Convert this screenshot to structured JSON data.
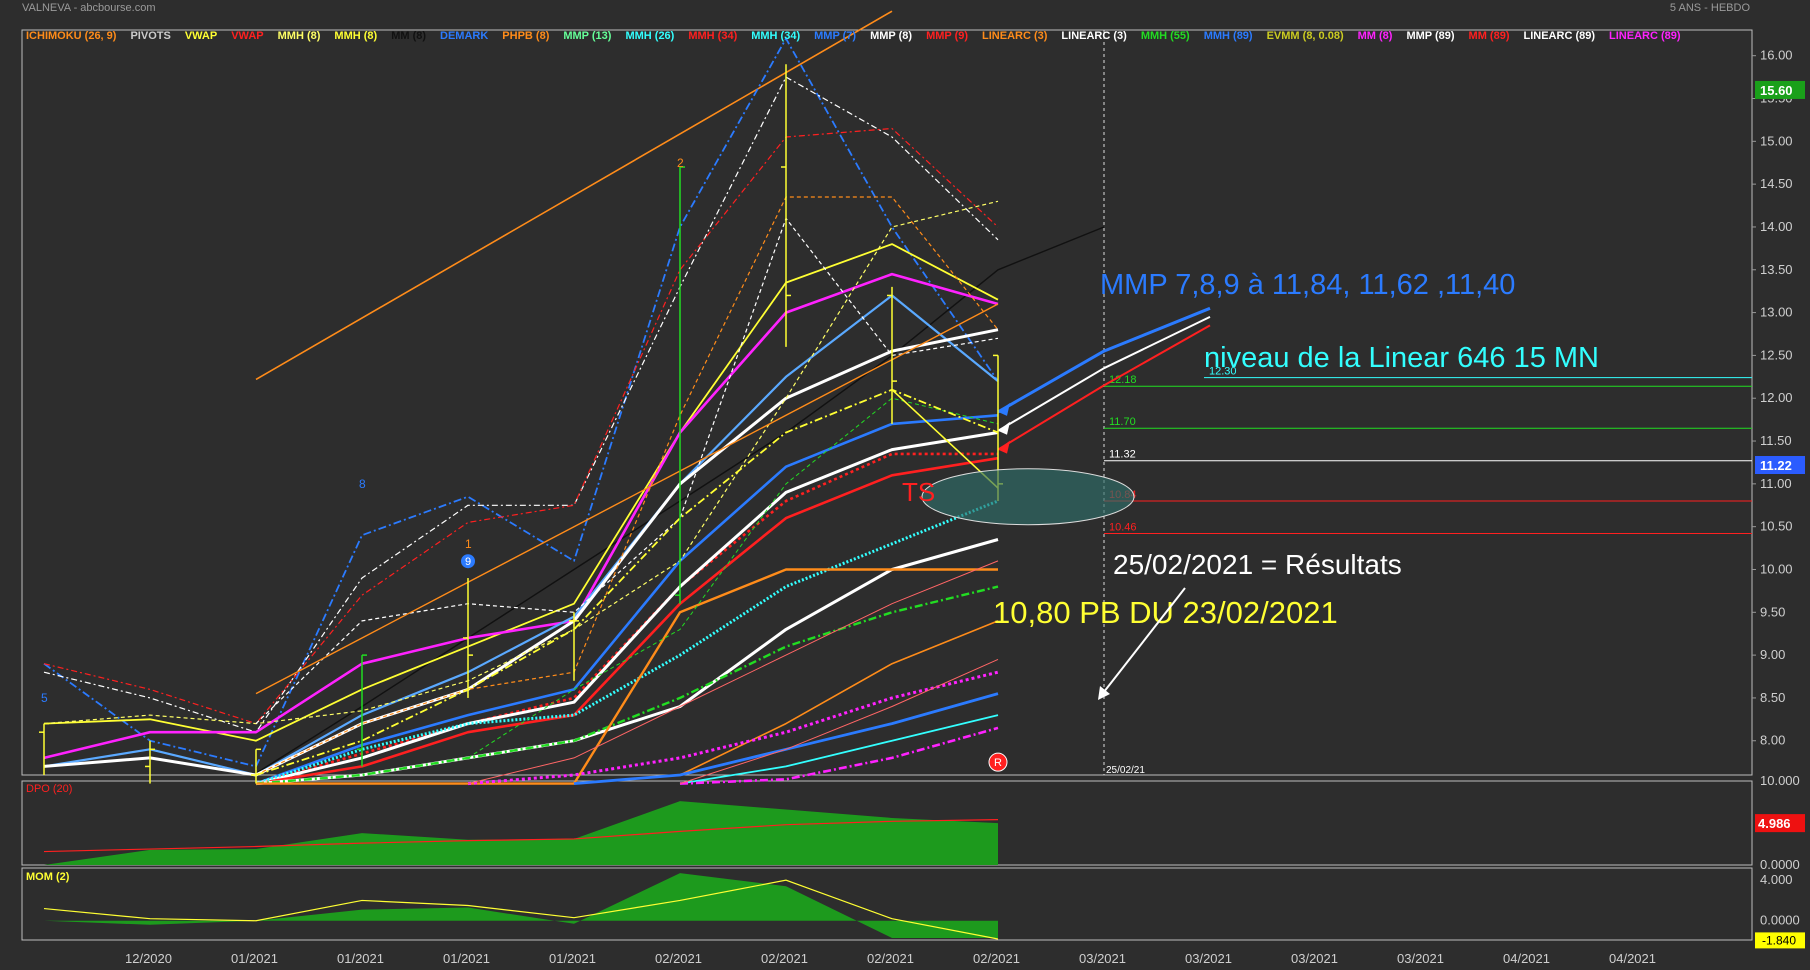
{
  "header": {
    "symbol_title": "VALNEVA - abcbourse.com",
    "period_title": "5 ANS - HEBDO"
  },
  "colors": {
    "background": "#2d2d2d",
    "grid": "#3e3e3e",
    "axis_text": "#cfcfcf",
    "white": "#ffffff",
    "yellow": "#ffff33",
    "magenta": "#ff22ff",
    "blue": "#2b7bff",
    "red": "#ff2020",
    "cyan": "#33ffff",
    "green": "#22dd22",
    "orange": "#ff8c1a"
  },
  "legend": [
    {
      "label": "ICHIMOKU (26, 9)",
      "color": "#ff8c1a"
    },
    {
      "label": "PIVOTS",
      "color": "#cccccc"
    },
    {
      "label": "VWAP",
      "color": "#ffff33"
    },
    {
      "label": "VWAP",
      "color": "#ff2020"
    },
    {
      "label": "MMH (8)",
      "color": "#ffff66"
    },
    {
      "label": "MMH (8)",
      "color": "#ffff33"
    },
    {
      "label": "MM (8)",
      "color": "#111111"
    },
    {
      "label": "DEMARK",
      "color": "#2b7bff"
    },
    {
      "label": "PHPB (8)",
      "color": "#ff8c1a"
    },
    {
      "label": "MMP (13)",
      "color": "#66ff99"
    },
    {
      "label": "MMH (26)",
      "color": "#33ffff"
    },
    {
      "label": "MMH (34)",
      "color": "#ff2020"
    },
    {
      "label": "MMH (34)",
      "color": "#33ffff"
    },
    {
      "label": "MMP (7)",
      "color": "#2b7bff"
    },
    {
      "label": "MMP (8)",
      "color": "#ffffff"
    },
    {
      "label": "MMP (9)",
      "color": "#ff2020"
    },
    {
      "label": "LINEARC (3)",
      "color": "#ff8c1a"
    },
    {
      "label": "LINEARC (3)",
      "color": "#ffffff"
    },
    {
      "label": "MMH (55)",
      "color": "#22dd22"
    },
    {
      "label": "MMH (89)",
      "color": "#2b7bff"
    },
    {
      "label": "EVMM (8, 0.08)",
      "color": "#cccc22"
    },
    {
      "label": "MM (8)",
      "color": "#ff22ff"
    },
    {
      "label": "MMP (89)",
      "color": "#ffffff"
    },
    {
      "label": "MM (89)",
      "color": "#ff2020"
    },
    {
      "label": "LINEARC (89)",
      "color": "#ffffff"
    },
    {
      "label": "LINEARC (89)",
      "color": "#ff22ff"
    }
  ],
  "chart_data": {
    "type": "line",
    "x_labels": [
      "12/2020",
      "01/2021",
      "01/2021",
      "01/2021",
      "01/2021",
      "02/2021",
      "02/2021",
      "02/2021",
      "02/2021",
      "03/2021",
      "03/2021",
      "03/2021",
      "03/2021",
      "04/2021",
      "04/2021"
    ],
    "main_panel": {
      "ylim": [
        7.6,
        16.3
      ],
      "y_ticks": [
        "16.00",
        "15.50",
        "15.00",
        "14.50",
        "14.00",
        "13.50",
        "13.00",
        "12.50",
        "12.00",
        "11.50",
        "11.00",
        "10.50",
        "10.00",
        "9.50",
        "9.00",
        "8.50",
        "8.00"
      ],
      "last_price_label": "11.22",
      "last_price": 11.22,
      "green_tag_label": "15.60",
      "green_tag_value": 15.6,
      "candles": [
        {
          "open": 8.1,
          "close": 8.2,
          "high": 8.2,
          "low": 7.6
        },
        {
          "open": 7.7,
          "close": 7.9,
          "high": 8.0,
          "low": 7.5
        },
        {
          "open": 7.6,
          "close": 7.9,
          "high": 7.9,
          "low": 7.5
        },
        {
          "open": 7.9,
          "close": 9.0,
          "high": 9.0,
          "low": 7.7
        },
        {
          "open": 9.2,
          "close": 9.0,
          "high": 9.9,
          "low": 8.5
        },
        {
          "open": 9.4,
          "close": 9.4,
          "high": 9.5,
          "low": 8.7
        },
        {
          "open": 9.7,
          "close": 14.7,
          "high": 14.7,
          "low": 9.6
        },
        {
          "open": 14.7,
          "close": 13.2,
          "high": 15.9,
          "low": 12.6
        },
        {
          "open": 13.2,
          "close": 12.2,
          "high": 13.3,
          "low": 11.7
        },
        {
          "open": 12.5,
          "close": 11.0,
          "high": 12.5,
          "low": 10.8
        }
      ],
      "levels": [
        {
          "label": "12.30",
          "value": 12.24,
          "color": "#33ffff"
        },
        {
          "label": "12.18",
          "value": 12.14,
          "color": "#22dd22"
        },
        {
          "label": "11.70",
          "value": 11.65,
          "color": "#22dd22"
        },
        {
          "label": "11.32",
          "value": 11.27,
          "color": "#ffffff"
        },
        {
          "label": "10.84",
          "value": 10.8,
          "color": "#ff2020"
        },
        {
          "label": "10.46",
          "value": 10.42,
          "color": "#ff2020"
        }
      ],
      "pivot_markers": [
        {
          "label": "5",
          "x": 0,
          "y": 8.45,
          "color": "#2b7bff"
        },
        {
          "label": "8",
          "x": 3,
          "y": 10.95,
          "color": "#2b7bff"
        },
        {
          "label": "1",
          "x": 4,
          "y": 10.25,
          "color": "#ff8c1a"
        },
        {
          "label": "9",
          "x": 4,
          "y": 10.05,
          "color": "#2b7bff"
        },
        {
          "label": "2",
          "x": 6,
          "y": 14.7,
          "color": "#ff8c1a"
        }
      ],
      "series": [
        {
          "color": "#ff8c1a",
          "width": 1.6,
          "dash": "",
          "values": [
            null,
            null,
            12.22,
            null,
            null,
            null,
            null,
            null,
            16.52
          ]
        },
        {
          "color": "#111111",
          "width": 1.4,
          "dash": "",
          "values": [
            null,
            null,
            7.62,
            8.4,
            9.2,
            10.0,
            10.8,
            11.6,
            12.5,
            13.5,
            14.0
          ]
        },
        {
          "color": "#2b7bff",
          "width": 1.8,
          "dash": "8,3,2,3",
          "values": [
            8.9,
            8.0,
            7.7,
            10.4,
            10.85,
            10.1,
            14.0,
            16.2,
            14.0,
            12.2
          ]
        },
        {
          "color": "#ffffff",
          "width": 1.2,
          "dash": "6,3,2,3",
          "values": [
            8.8,
            8.5,
            8.1,
            9.9,
            10.75,
            10.75,
            13.3,
            15.75,
            15.05,
            13.85
          ]
        },
        {
          "color": "#ff2020",
          "width": 1.2,
          "dash": "6,3,2,3",
          "values": [
            8.9,
            8.6,
            8.2,
            9.7,
            10.55,
            10.75,
            13.5,
            15.05,
            15.15,
            14.0
          ]
        },
        {
          "color": "#ffff33",
          "width": 1.8,
          "dash": "",
          "values": [
            8.2,
            8.25,
            8.0,
            8.6,
            9.1,
            9.6,
            11.6,
            13.35,
            13.8,
            13.15
          ]
        },
        {
          "color": "#ff22ff",
          "width": 2.6,
          "dash": "",
          "values": [
            7.8,
            8.1,
            8.1,
            8.9,
            9.2,
            9.4,
            11.6,
            13.0,
            13.45,
            13.1
          ]
        },
        {
          "color": "#5aa9ff",
          "width": 2.2,
          "dash": "",
          "values": [
            7.7,
            7.9,
            7.6,
            8.3,
            8.8,
            9.45,
            11.0,
            12.25,
            13.2,
            12.2
          ]
        },
        {
          "color": "#ffffff",
          "width": 3.0,
          "dash": "",
          "values": [
            7.7,
            7.8,
            7.6,
            8.2,
            8.6,
            9.4,
            11.0,
            12.0,
            12.55,
            12.8
          ]
        },
        {
          "color": "#2b7bff",
          "width": 2.6,
          "dash": "",
          "values": [
            null,
            null,
            7.5,
            7.95,
            8.3,
            8.6,
            10.1,
            11.2,
            11.7,
            11.8
          ]
        },
        {
          "color": "#ff2020",
          "width": 2.6,
          "dash": "3,3",
          "values": [
            null,
            null,
            7.5,
            7.85,
            8.2,
            8.5,
            9.8,
            10.8,
            11.35,
            11.35
          ]
        },
        {
          "color": "#ffffff",
          "width": 3.0,
          "dash": "",
          "values": [
            null,
            null,
            7.5,
            7.8,
            8.2,
            8.45,
            9.8,
            10.9,
            11.4,
            11.6
          ]
        },
        {
          "color": "#ff2020",
          "width": 2.6,
          "dash": "",
          "values": [
            null,
            null,
            7.5,
            7.7,
            8.1,
            8.3,
            9.6,
            10.6,
            11.1,
            11.3
          ]
        },
        {
          "color": "#33ffff",
          "width": 3.0,
          "dash": "2,2",
          "values": [
            null,
            null,
            7.5,
            7.9,
            8.2,
            8.3,
            9.0,
            9.8,
            10.3,
            10.8
          ]
        },
        {
          "color": "#ffffff",
          "width": 3.0,
          "dash": "",
          "values": [
            null,
            null,
            7.5,
            7.6,
            7.8,
            8.0,
            8.4,
            9.3,
            10.0,
            10.35
          ]
        },
        {
          "color": "#22dd22",
          "width": 2.4,
          "dash": "8,3,2,3",
          "values": [
            null,
            null,
            7.5,
            7.6,
            7.8,
            8.0,
            8.5,
            9.1,
            9.5,
            9.8
          ]
        },
        {
          "color": "#ff8c1a",
          "width": 2.4,
          "dash": "",
          "values": [
            null,
            null,
            7.5,
            7.5,
            7.5,
            7.5,
            9.5,
            10.0,
            10.0,
            10.0
          ]
        },
        {
          "color": "#ff8c1a",
          "width": 1.6,
          "dash": "",
          "values": [
            null,
            null,
            7.5,
            7.5,
            7.5,
            7.5,
            7.6,
            8.2,
            8.9,
            9.4
          ]
        },
        {
          "color": "#ff22ff",
          "width": 3.0,
          "dash": "3,3",
          "values": [
            null,
            null,
            null,
            null,
            7.5,
            7.6,
            7.8,
            8.1,
            8.5,
            8.8
          ]
        },
        {
          "color": "#2b7bff",
          "width": 2.8,
          "dash": "",
          "values": [
            null,
            null,
            null,
            null,
            null,
            7.5,
            7.6,
            7.9,
            8.2,
            8.55
          ]
        },
        {
          "color": "#33ffff",
          "width": 1.8,
          "dash": "",
          "values": [
            null,
            null,
            null,
            null,
            null,
            null,
            7.5,
            7.7,
            8.0,
            8.3
          ]
        },
        {
          "color": "#ff22ff",
          "width": 2.6,
          "dash": "8,3,2,3",
          "values": [
            null,
            null,
            null,
            null,
            null,
            null,
            7.5,
            7.55,
            7.8,
            8.15
          ]
        },
        {
          "color": "#ffff66",
          "width": 1.2,
          "dash": "4,3",
          "values": [
            8.2,
            8.3,
            8.2,
            8.35,
            8.7,
            9.3,
            10.1,
            12.0,
            14.0,
            14.3
          ]
        },
        {
          "color": "#ffffff",
          "width": 1.2,
          "dash": "4,3",
          "values": [
            null,
            null,
            8.2,
            9.4,
            9.6,
            9.5,
            10.6,
            14.1,
            12.5,
            12.7
          ]
        },
        {
          "color": "#ff8c1a",
          "width": 1.2,
          "dash": "4,3",
          "values": [
            null,
            null,
            7.6,
            8.2,
            8.6,
            8.8,
            11.8,
            14.35,
            14.35,
            12.8
          ]
        },
        {
          "color": "#22dd22",
          "width": 1.0,
          "dash": "4,3",
          "values": [
            null,
            null,
            null,
            null,
            7.8,
            8.6,
            9.3,
            11.0,
            12.0,
            11.7
          ]
        },
        {
          "color": "#ffff33",
          "width": 1.8,
          "dash": "8,3,2,3",
          "values": [
            null,
            null,
            7.6,
            8.0,
            8.6,
            9.3,
            10.6,
            11.6,
            12.1,
            11.6
          ]
        },
        {
          "color": "#ffff33",
          "width": 1.6,
          "dash": "",
          "values": [
            null,
            null,
            null,
            null,
            null,
            null,
            null,
            null,
            12.1,
            10.95
          ]
        },
        {
          "color": "#ff8c1a",
          "width": 1.4,
          "dash": "",
          "values": [
            null,
            null,
            8.55,
            9.2,
            9.85,
            10.5,
            11.15,
            11.8,
            12.45,
            13.1
          ]
        },
        {
          "color": "#ff6666",
          "width": 1.0,
          "dash": "",
          "values": [
            null,
            null,
            null,
            null,
            7.5,
            7.8,
            8.4,
            9.0,
            9.6,
            10.1
          ]
        },
        {
          "color": "#ff6666",
          "width": 1.0,
          "dash": "",
          "values": [
            null,
            null,
            null,
            null,
            null,
            null,
            7.5,
            7.9,
            8.4,
            8.95
          ]
        },
        {
          "color": "#2b7bff",
          "width": 3.0,
          "dash": "",
          "values": [
            null,
            null,
            null,
            null,
            null,
            null,
            null,
            null,
            null,
            11.84,
            12.55,
            13.05
          ]
        },
        {
          "color": "#ffffff",
          "width": 2.0,
          "dash": "",
          "values": [
            null,
            null,
            null,
            null,
            null,
            null,
            null,
            null,
            null,
            11.62,
            12.35,
            12.95
          ]
        },
        {
          "color": "#ff2020",
          "width": 2.0,
          "dash": "",
          "values": [
            null,
            null,
            null,
            null,
            null,
            null,
            null,
            null,
            null,
            11.4,
            12.15,
            12.85
          ]
        }
      ],
      "vertical_marker_label": "25/02/21",
      "ts_label": "TS",
      "r_badge_label": "R"
    },
    "annotations": {
      "mmp_text": "MMP 7,8,9 à 11,84, 11,62 ,11,40",
      "linear_text": "niveau de la Linear 646 15 MN",
      "results_text": "25/02/2021 = Résultats",
      "pb_text": "10,80 PB DU 23/02/2021"
    },
    "dpo_panel": {
      "title": "DPO (20)",
      "ylim": [
        0,
        10
      ],
      "y_ticks": [
        "10.000",
        "5.000",
        "0.0000"
      ],
      "last_label": "4.986",
      "last_value": 4.986,
      "histogram": [
        0,
        1.8,
        1.9,
        3.8,
        3.0,
        3.1,
        7.6,
        6.6,
        5.6,
        4.99
      ],
      "signal": [
        1.6,
        1.9,
        2.2,
        2.6,
        2.9,
        3.1,
        4.0,
        4.8,
        5.2,
        5.4
      ]
    },
    "mom_panel": {
      "title": "MOM (2)",
      "ylim": [
        -1.9,
        5.2
      ],
      "y_ticks": [
        "4.000",
        "0.0000"
      ],
      "last_label": "-1.840",
      "last_value": -1.84,
      "histogram": [
        0,
        -0.4,
        0,
        1.1,
        1.3,
        -0.3,
        4.7,
        3.4,
        -1.7,
        -1.7
      ],
      "signal": [
        1.2,
        0.2,
        0.0,
        2.0,
        1.5,
        0.3,
        2.0,
        4.0,
        0.2,
        -1.8
      ]
    }
  }
}
